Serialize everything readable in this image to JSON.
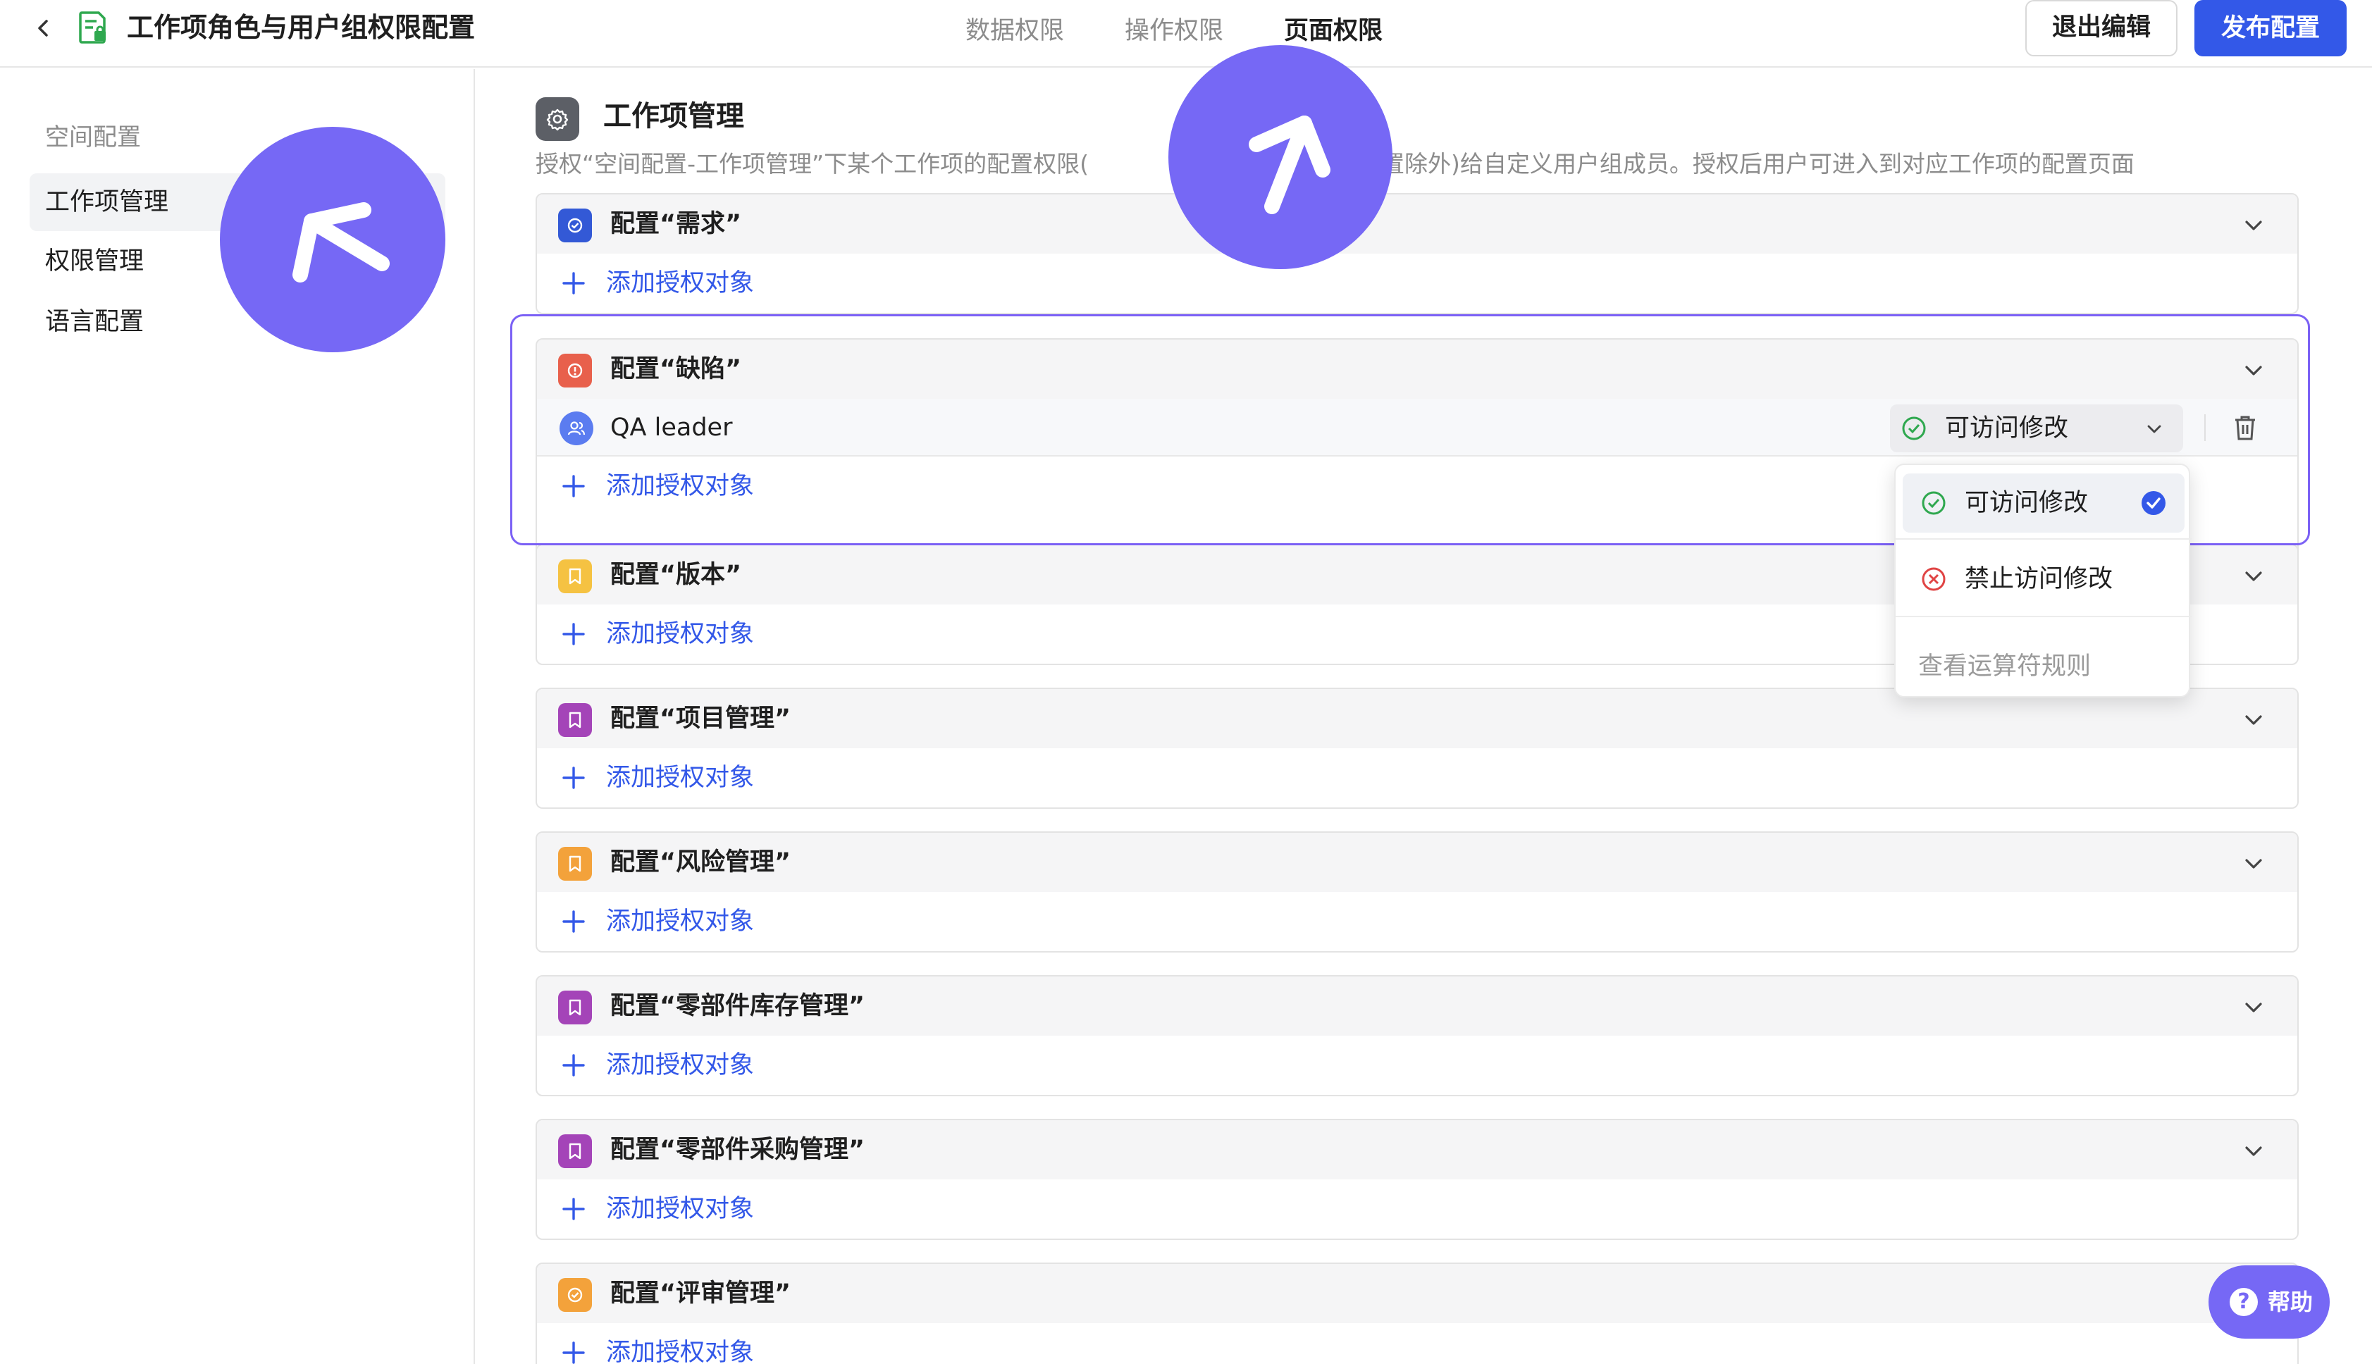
{
  "header": {
    "title": "工作项角色与用户组权限配置",
    "tabs": [
      {
        "label": "数据权限",
        "active": false
      },
      {
        "label": "操作权限",
        "active": false
      },
      {
        "label": "页面权限",
        "active": true
      }
    ],
    "exit_label": "退出编辑",
    "publish_label": "发布配置"
  },
  "sidebar": {
    "group_label": "空间配置",
    "items": [
      {
        "label": "工作项管理",
        "active": true
      },
      {
        "label": "权限管理",
        "active": false
      },
      {
        "label": "语言配置",
        "active": false
      }
    ]
  },
  "main": {
    "section_title": "工作项管理",
    "section_desc": "授权“空间配置-工作项管理”下某个工作项的配置权限(",
    "section_desc_tail": "权限配置除外)给自定义用户组成员。授权后用户可进入到对应工作项的配置页面",
    "add_label": "添加授权对象",
    "cards": [
      {
        "title": "配置“需求”",
        "icon_color": "#3359d6",
        "icon": "check-circle-icon"
      },
      {
        "title": "配置“缺陷”",
        "icon_color": "#e8604c",
        "icon": "alert-circle-icon",
        "member": {
          "name": "QA leader",
          "permission": "可访问修改"
        }
      },
      {
        "title": "配置“版本”",
        "icon_color": "#f5c242",
        "icon": "bookmark-icon"
      },
      {
        "title": "配置“项目管理”",
        "icon_color": "#a444b8",
        "icon": "bookmark-icon"
      },
      {
        "title": "配置“风险管理”",
        "icon_color": "#f3a23b",
        "icon": "bookmark-icon"
      },
      {
        "title": "配置“零部件库存管理”",
        "icon_color": "#a444b8",
        "icon": "bookmark-icon"
      },
      {
        "title": "配置“零部件采购管理”",
        "icon_color": "#a444b8",
        "icon": "bookmark-icon"
      },
      {
        "title": "配置“评审管理”",
        "icon_color": "#f3a23b",
        "icon": "check-circle-icon"
      }
    ]
  },
  "dropdown": {
    "options": [
      {
        "label": "可访问修改",
        "selected": true
      },
      {
        "label": "禁止访问修改",
        "selected": false
      }
    ],
    "link_label": "查看运算符规则"
  },
  "help": {
    "label": "帮助"
  },
  "colors": {
    "accent": "#3358e8",
    "overlay": "#7668f5",
    "ok": "#2fa84f",
    "danger": "#e04444"
  }
}
